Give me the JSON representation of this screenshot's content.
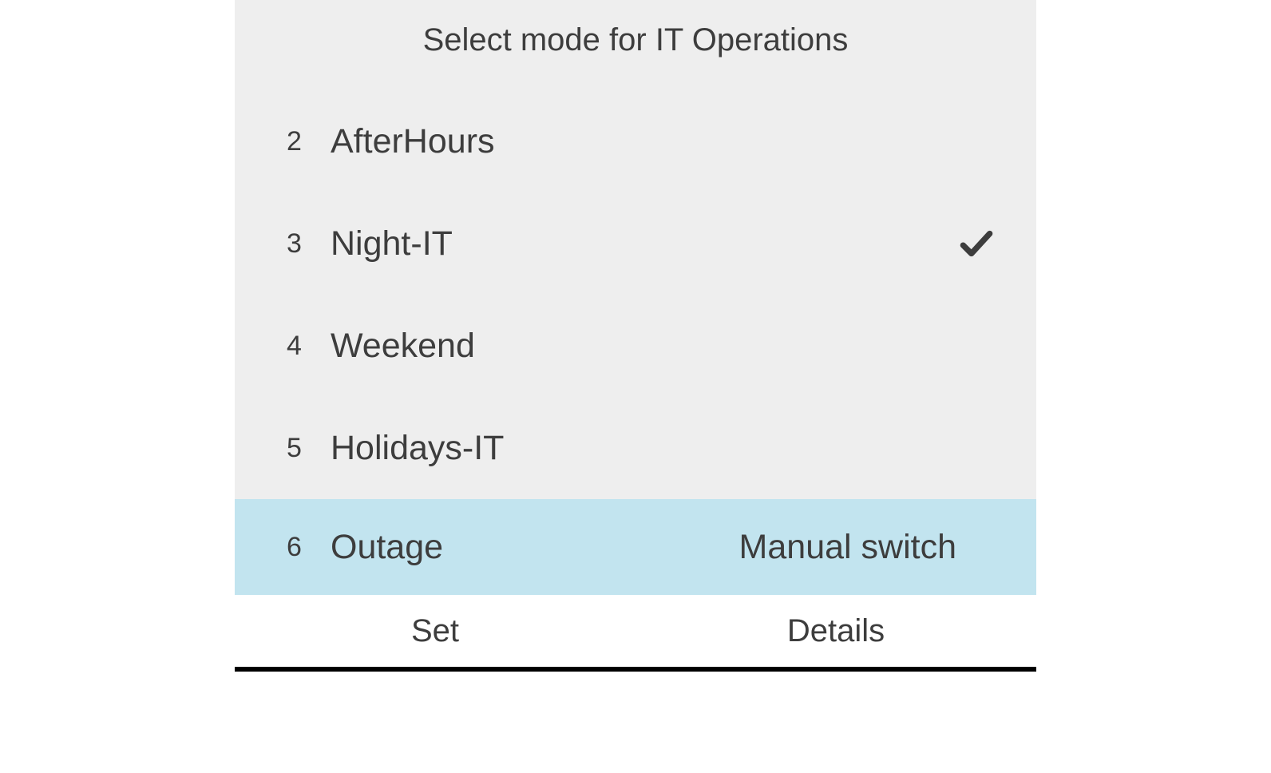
{
  "title": "Select mode for IT Operations",
  "modes": [
    {
      "num": "2",
      "label": "AfterHours",
      "checked": false,
      "extra": "",
      "highlighted": false
    },
    {
      "num": "3",
      "label": "Night-IT",
      "checked": true,
      "extra": "",
      "highlighted": false
    },
    {
      "num": "4",
      "label": "Weekend",
      "checked": false,
      "extra": "",
      "highlighted": false
    },
    {
      "num": "5",
      "label": "Holidays-IT",
      "checked": false,
      "extra": "",
      "highlighted": false
    },
    {
      "num": "6",
      "label": "Outage",
      "checked": false,
      "extra": "Manual switch",
      "highlighted": true
    }
  ],
  "actions": {
    "set": "Set",
    "details": "Details"
  }
}
